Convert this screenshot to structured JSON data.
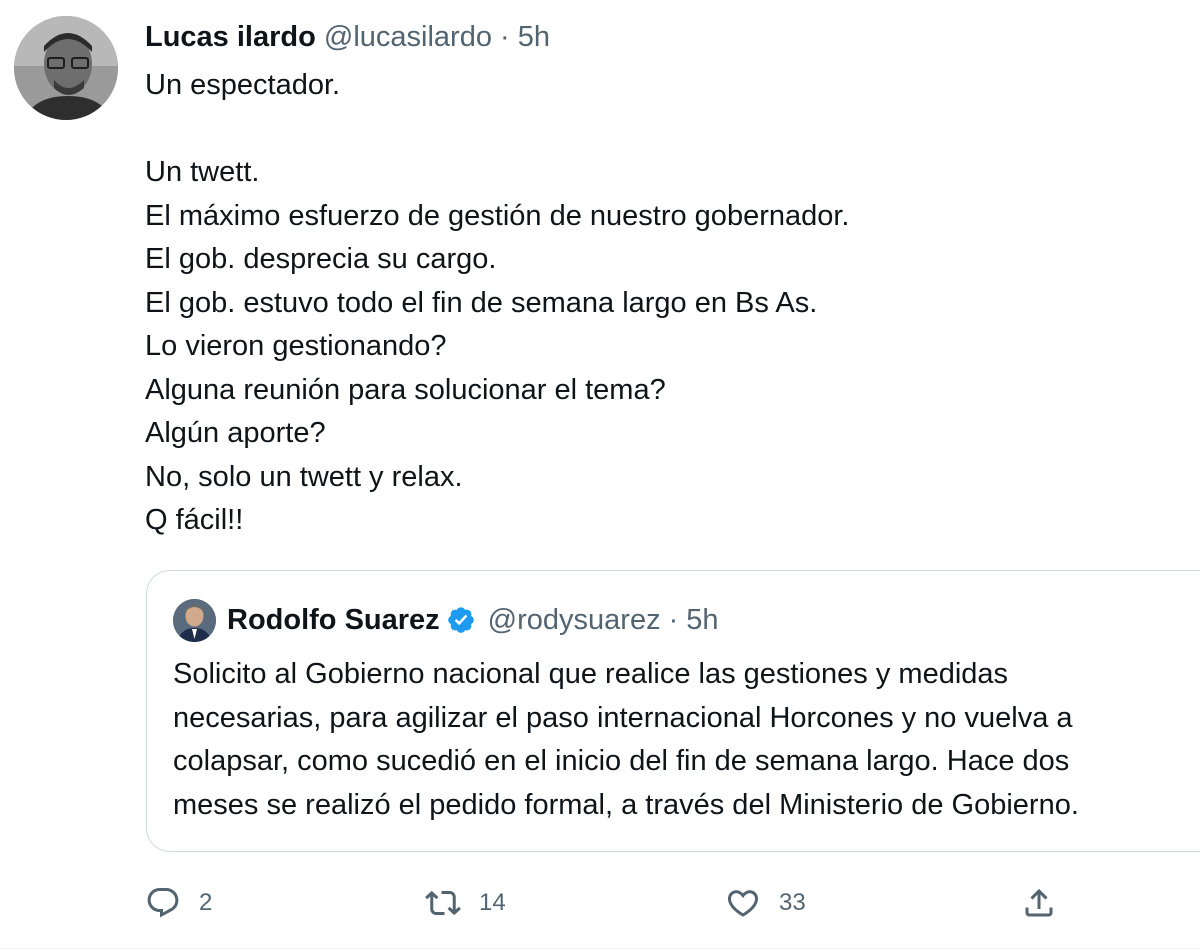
{
  "tweet": {
    "author": {
      "name": "Lucas ilardo",
      "handle": "@lucasilardo",
      "separator": "·",
      "time": "5h"
    },
    "lines": [
      "Un espectador.",
      "",
      "Un twett.",
      "El máximo esfuerzo de gestión de nuestro gobernador.",
      "El gob. desprecia su cargo.",
      "El gob. estuvo todo el fin de semana largo en Bs As.",
      "Lo vieron gestionando?",
      "Alguna reunión para solucionar el tema?",
      "Algún aporte?",
      "No, solo un twett y relax.",
      "Q fácil!!"
    ]
  },
  "quoted_tweet": {
    "author": {
      "name": "Rodolfo Suarez",
      "handle": "@rodysuarez",
      "separator": "·",
      "time": "5h",
      "verified_icon": "verified-badge-icon"
    },
    "lines": [
      "Solicito al Gobierno nacional que realice las gestiones y medidas",
      "necesarias, para agilizar el paso internacional Horcones y no vuelva a",
      "colapsar, como sucedió en el inicio del fin de semana largo. Hace dos",
      "meses se realizó el pedido formal, a través del Ministerio de Gobierno."
    ]
  },
  "actions": {
    "reply": {
      "icon": "reply-icon",
      "count": "2"
    },
    "retweet": {
      "icon": "retweet-icon",
      "count": "14"
    },
    "like": {
      "icon": "heart-icon",
      "count": "33"
    },
    "share": {
      "icon": "share-icon"
    }
  },
  "colors": {
    "text": "#0f1419",
    "secondary": "#536471",
    "border": "#cfd9de",
    "verified": "#1d9bf0"
  }
}
